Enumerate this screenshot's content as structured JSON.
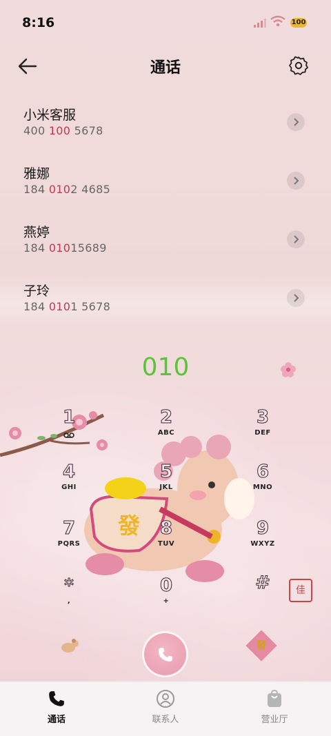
{
  "status_bar": {
    "time": "8:16",
    "battery": "100"
  },
  "header": {
    "title": "通话"
  },
  "calls": [
    {
      "name": "小米客服",
      "num_pre": "400 ",
      "num_hl": "100",
      "num_post": " 5678"
    },
    {
      "name": "雅娜",
      "num_pre": "184 ",
      "num_hl": "010",
      "num_post": "2 4685"
    },
    {
      "name": "燕婷",
      "num_pre": "184 ",
      "num_hl": "010",
      "num_post": "15689"
    },
    {
      "name": "子玲",
      "num_pre": "184 ",
      "num_hl": "010",
      "num_post": "1 5678"
    }
  ],
  "dialed": "010",
  "keys": [
    {
      "digit": "1",
      "letters": ""
    },
    {
      "digit": "2",
      "letters": "ABC"
    },
    {
      "digit": "3",
      "letters": "DEF"
    },
    {
      "digit": "4",
      "letters": "GHI"
    },
    {
      "digit": "5",
      "letters": "JKL"
    },
    {
      "digit": "6",
      "letters": "MNO"
    },
    {
      "digit": "7",
      "letters": "PQRS"
    },
    {
      "digit": "8",
      "letters": "TUV"
    },
    {
      "digit": "9",
      "letters": "WXYZ"
    },
    {
      "digit": "*",
      "letters": ","
    },
    {
      "digit": "0",
      "letters": "+"
    },
    {
      "digit": "#",
      "letters": ""
    }
  ],
  "decor": {
    "horse_badge": "發",
    "seal": "佳"
  },
  "nav": {
    "tabs": [
      {
        "label": "通话",
        "icon": "phone-icon",
        "active": true
      },
      {
        "label": "联系人",
        "icon": "contact-icon",
        "active": false
      },
      {
        "label": "营业厅",
        "icon": "bag-icon",
        "active": false
      }
    ]
  },
  "colors": {
    "accent_green": "#5cc43a",
    "highlight": "#c0394f",
    "call_button": "#e99aae"
  }
}
